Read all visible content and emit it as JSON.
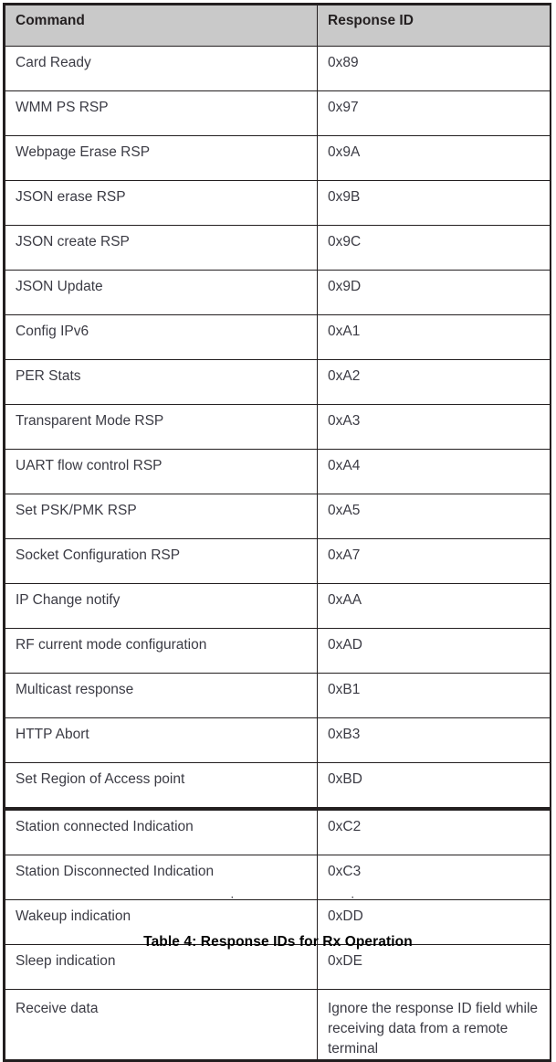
{
  "table": {
    "columns": [
      "Command",
      "Response ID"
    ],
    "rows": [
      {
        "command": "Card Ready",
        "response_id": "0x89"
      },
      {
        "command": "WMM PS RSP",
        "response_id": "0x97"
      },
      {
        "command": "Webpage Erase RSP",
        "response_id": "0x9A"
      },
      {
        "command": "JSON erase RSP",
        "response_id": "0x9B"
      },
      {
        "command": "JSON create RSP",
        "response_id": "0x9C"
      },
      {
        "command": "JSON Update",
        "response_id": "0x9D"
      },
      {
        "command": "Config IPv6",
        "response_id": "0xA1"
      },
      {
        "command": "PER Stats",
        "response_id": "0xA2"
      },
      {
        "command": "Transparent Mode RSP",
        "response_id": "0xA3"
      },
      {
        "command": "UART flow control RSP",
        "response_id": "0xA4"
      },
      {
        "command": "Set PSK/PMK RSP",
        "response_id": "0xA5"
      },
      {
        "command": "Socket Configuration RSP",
        "response_id": "0xA7"
      },
      {
        "command": "IP Change notify",
        "response_id": "0xAA"
      },
      {
        "command": "RF current mode configuration",
        "response_id": "0xAD"
      },
      {
        "command": "Multicast response",
        "response_id": "0xB1"
      },
      {
        "command": "HTTP Abort",
        "response_id": "0xB3"
      },
      {
        "command": "Set Region of Access point",
        "response_id": "0xBD"
      },
      {
        "command": "Station connected Indication",
        "response_id": "0xC2"
      },
      {
        "command": "Station Disconnected Indication",
        "response_id": "0xC3"
      },
      {
        "command": "Wakeup indication",
        "response_id": "0xDD"
      },
      {
        "command": "Sleep indication",
        "response_id": "0xDE"
      },
      {
        "command": "Receive data",
        "response_id": "Ignore the response ID field while receiving data from a remote terminal"
      }
    ]
  },
  "caption": "Table 4: Response IDs for Rx Operation",
  "colors": {
    "header_background": "#c9c9c9",
    "border": "#231f20",
    "body_text": "#3b3b44",
    "caption_text": "#000000",
    "page_background": "#ffffff"
  }
}
